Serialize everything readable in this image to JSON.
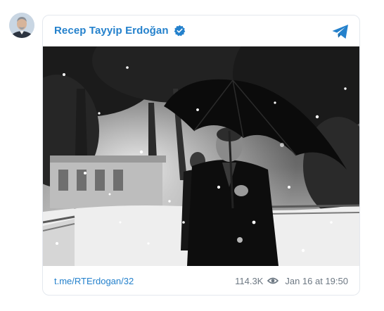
{
  "post": {
    "author_name": "Recep Tayyip Erdoğan",
    "link_text": "t.me/RTErdogan/32",
    "views": "114.3K",
    "date": "Jan 16 at 19:50"
  },
  "icons": {
    "verified": "verified-check-icon",
    "share": "telegram-paper-plane-icon",
    "views": "eye-icon"
  },
  "colors": {
    "accent": "#2481cc",
    "muted": "#6d7883",
    "border": "#e4e8ee"
  }
}
